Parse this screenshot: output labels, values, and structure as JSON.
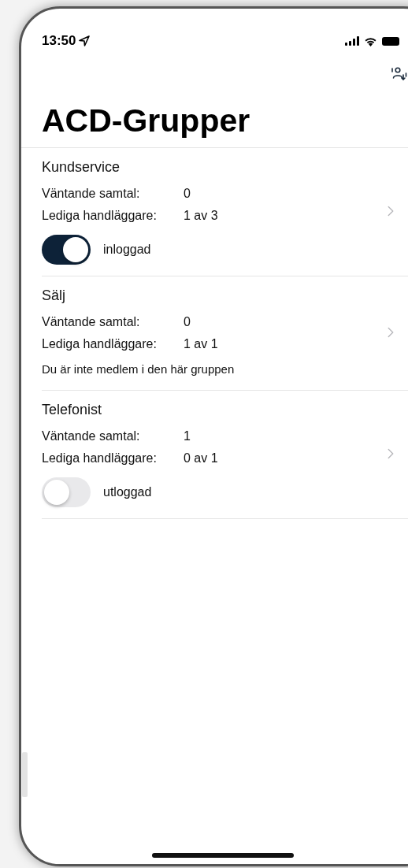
{
  "status_bar": {
    "time": "13:50"
  },
  "title": "ACD-Grupper",
  "groups": [
    {
      "name": "Kundservice",
      "kind": "member",
      "rows": [
        {
          "label": "Väntande samtal:",
          "value": "0"
        },
        {
          "label": "Lediga handläggare:",
          "value": "1 av 3"
        }
      ],
      "toggle": {
        "on": true,
        "label": "inloggad"
      }
    },
    {
      "name": "Sälj",
      "kind": "non-member",
      "rows": [
        {
          "label": "Väntande samtal:",
          "value": "0"
        },
        {
          "label": "Lediga handläggare:",
          "value": "1 av 1"
        }
      ],
      "note": "Du är inte medlem i den här gruppen"
    },
    {
      "name": "Telefonist",
      "kind": "member",
      "rows": [
        {
          "label": "Väntande samtal:",
          "value": "1"
        },
        {
          "label": "Lediga handläggare:",
          "value": "0 av 1"
        }
      ],
      "toggle": {
        "on": false,
        "label": "utloggad"
      }
    }
  ]
}
